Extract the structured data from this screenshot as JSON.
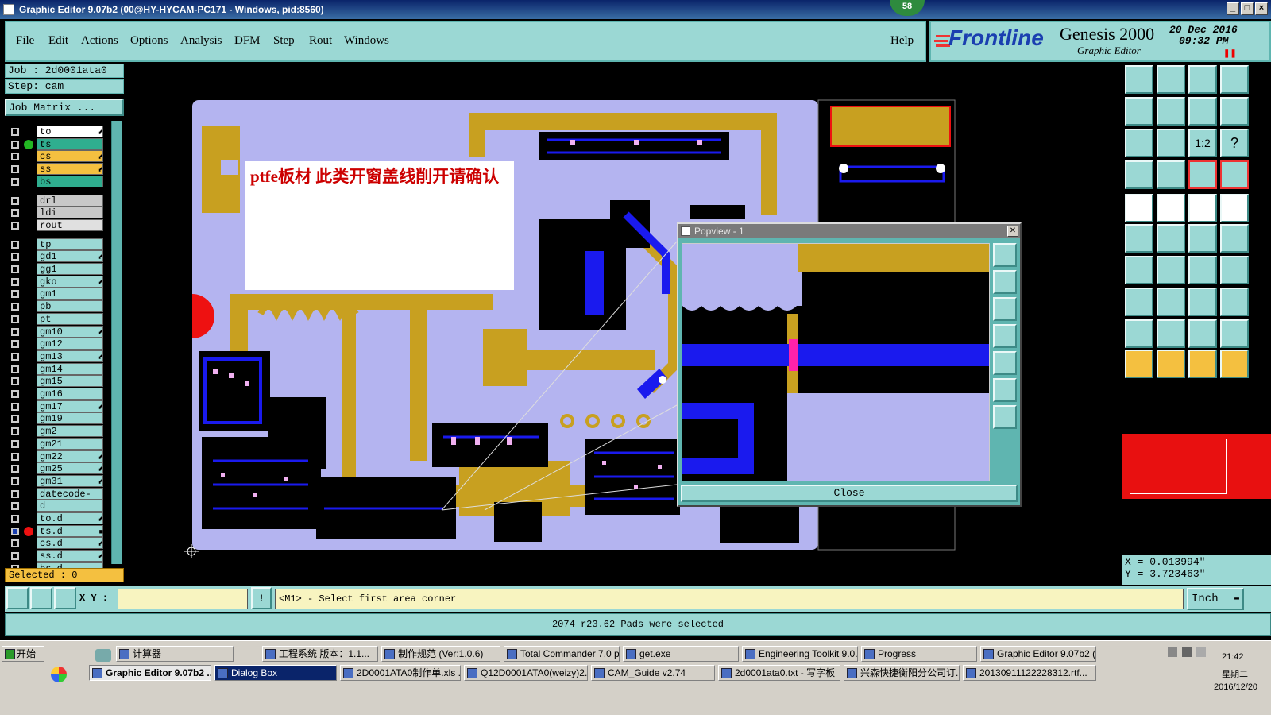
{
  "window": {
    "title": "Graphic Editor 9.07b2 (00@HY-HYCAM-PC171 - Windows, pid:8560)",
    "badge": "58"
  },
  "menu": {
    "items": [
      "File",
      "Edit",
      "Actions",
      "Options",
      "Analysis",
      "DFM",
      "Step",
      "Rout",
      "Windows"
    ],
    "help": "Help"
  },
  "brand": {
    "logo": "Frontline",
    "product": "Genesis 2000",
    "subtitle": "Graphic Editor",
    "date": "20 Dec 2016",
    "time": "09:32 PM"
  },
  "job": {
    "job_line": "Job : 2d0001ata0",
    "step_line": "Step: cam",
    "matrix_button": "Job Matrix ..."
  },
  "layers": [
    {
      "name": "to",
      "color": "#ffffff",
      "flag": "⬋",
      "dot": ""
    },
    {
      "name": "ts",
      "color": "#2fae8f",
      "flag": "",
      "dot": "#22b822"
    },
    {
      "name": "cs",
      "color": "#f4c040",
      "flag": "⬋",
      "dot": ""
    },
    {
      "name": "ss",
      "color": "#f4c040",
      "flag": "⬋",
      "dot": ""
    },
    {
      "name": "bs",
      "color": "#2fae8f",
      "flag": "",
      "dot": ""
    },
    {
      "name": "drl",
      "color": "#c8c8c8",
      "flag": "",
      "dot": ""
    },
    {
      "name": "ldi",
      "color": "#c8c8c8",
      "flag": "",
      "dot": ""
    },
    {
      "name": "rout",
      "color": "#e0e0e0",
      "flag": "",
      "dot": ""
    },
    {
      "name": "tp",
      "color": "#9bd8d4",
      "flag": "",
      "dot": ""
    },
    {
      "name": "gd1",
      "color": "#9bd8d4",
      "flag": "⬋",
      "dot": ""
    },
    {
      "name": "gg1",
      "color": "#9bd8d4",
      "flag": "",
      "dot": ""
    },
    {
      "name": "gko",
      "color": "#9bd8d4",
      "flag": "⬋",
      "dot": ""
    },
    {
      "name": "gm1",
      "color": "#9bd8d4",
      "flag": "",
      "dot": ""
    },
    {
      "name": "pb",
      "color": "#9bd8d4",
      "flag": "",
      "dot": ""
    },
    {
      "name": "pt",
      "color": "#9bd8d4",
      "flag": "",
      "dot": ""
    },
    {
      "name": "gm10",
      "color": "#9bd8d4",
      "flag": "⬋",
      "dot": ""
    },
    {
      "name": "gm12",
      "color": "#9bd8d4",
      "flag": "",
      "dot": ""
    },
    {
      "name": "gm13",
      "color": "#9bd8d4",
      "flag": "⬋",
      "dot": ""
    },
    {
      "name": "gm14",
      "color": "#9bd8d4",
      "flag": "",
      "dot": ""
    },
    {
      "name": "gm15",
      "color": "#9bd8d4",
      "flag": "",
      "dot": ""
    },
    {
      "name": "gm16",
      "color": "#9bd8d4",
      "flag": "",
      "dot": ""
    },
    {
      "name": "gm17",
      "color": "#9bd8d4",
      "flag": "⬋",
      "dot": ""
    },
    {
      "name": "gm19",
      "color": "#9bd8d4",
      "flag": "",
      "dot": ""
    },
    {
      "name": "gm2",
      "color": "#9bd8d4",
      "flag": "",
      "dot": ""
    },
    {
      "name": "gm21",
      "color": "#9bd8d4",
      "flag": "",
      "dot": ""
    },
    {
      "name": "gm22",
      "color": "#9bd8d4",
      "flag": "⬋",
      "dot": ""
    },
    {
      "name": "gm25",
      "color": "#9bd8d4",
      "flag": "⬋",
      "dot": ""
    },
    {
      "name": "gm31",
      "color": "#9bd8d4",
      "flag": "⬋",
      "dot": ""
    },
    {
      "name": "datecode-to",
      "color": "#9bd8d4",
      "flag": "",
      "dot": ""
    },
    {
      "name": "d",
      "color": "#9bd8d4",
      "flag": "",
      "dot": ""
    },
    {
      "name": "to.d",
      "color": "#9bd8d4",
      "flag": "⬋",
      "dot": ""
    },
    {
      "name": "ts.d",
      "color": "#9bd8d4",
      "flag": "■",
      "dot": "#ee1111"
    },
    {
      "name": "cs.d",
      "color": "#9bd8d4",
      "flag": "⬋",
      "dot": ""
    },
    {
      "name": "ss.d",
      "color": "#9bd8d4",
      "flag": "⬋",
      "dot": ""
    },
    {
      "name": "bs.d",
      "color": "#9bd8d4",
      "flag": "",
      "dot": ""
    }
  ],
  "selected": "Selected : 0",
  "note": {
    "text": "ptfe板材 此类开窗盖线削开请确认"
  },
  "popview": {
    "title": "Popview - 1",
    "close_label": "Close"
  },
  "coords": {
    "x": "X = 0.013994\"",
    "y": "Y = 3.723463\""
  },
  "cmd": {
    "xy_label": "X Y :",
    "xy_value": "",
    "prompt": "<M1> - Select first area corner",
    "units": "Inch"
  },
  "status": "2074 r23.62 Pads were selected",
  "taskbar": {
    "start": "开始",
    "row1": [
      "计算器",
      "工程系统  版本：1.1...",
      "制作规范 (Ver:1.0.6)",
      "Total Commander 7.0 p...",
      "get.exe",
      "Engineering Toolkit 9.0...",
      "Progress",
      "Graphic Editor 9.07b2 (..."
    ],
    "row2": [
      "Graphic Editor 9.07b2 ...",
      "Dialog Box",
      "2D0001ATA0制作单.xls ...",
      "Q12D0001ATA0(weizy)2...",
      "CAM_Guide v2.74",
      "2d0001ata0.txt - 写字板",
      "兴森快捷衡阳分公司订...",
      "20130911122228312.rtf..."
    ],
    "clock": "21:42",
    "weekday": "星期二",
    "date": "2016/12/20"
  },
  "colors": {
    "board": "#b4b4f0",
    "copper": "#c8a020",
    "blue": "#1a1aee",
    "panel": "#9bd8d4",
    "note_text": "#cc0000"
  }
}
